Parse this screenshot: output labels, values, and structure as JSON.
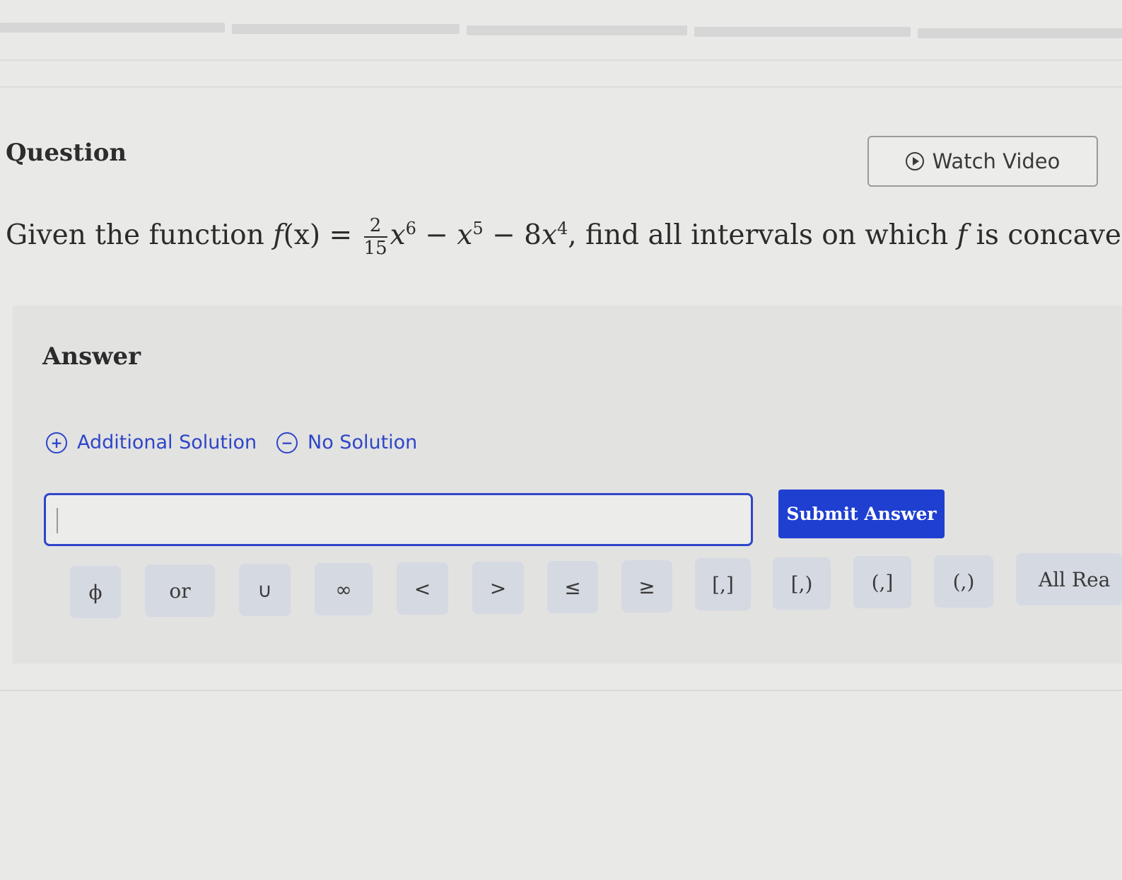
{
  "question": {
    "title": "Question",
    "watch_video_label": "Watch Video",
    "prompt_lead": "Given the function ",
    "func_f": "f",
    "func_arg": "(x) = ",
    "frac_num": "2",
    "frac_den": "15",
    "term1_base": "x",
    "term1_exp": "6",
    "term2_lead": " − ",
    "term2_base": "x",
    "term2_exp": "5",
    "term3_lead": " − 8",
    "term3_base": "x",
    "term3_exp": "4",
    "prompt_tail": ", find all intervals on which ",
    "prompt_f": "f",
    "prompt_end": " is concave u"
  },
  "answer": {
    "label": "Answer",
    "additional_solution": "Additional Solution",
    "additional_icon": "plus-circle-icon",
    "no_solution": "No Solution",
    "no_solution_icon": "minus-circle-icon",
    "input_value": "",
    "submit_label": "Submit Answer",
    "keypad": [
      "ϕ",
      "or",
      "∪",
      "∞",
      "<",
      ">",
      "≤",
      "≥",
      "[,]",
      "[,)",
      "(,]",
      "(,)",
      "All Rea"
    ]
  },
  "colors": {
    "accent": "#2f45c8",
    "submit": "#1f3fd1",
    "key_bg": "#d5d9e1"
  }
}
